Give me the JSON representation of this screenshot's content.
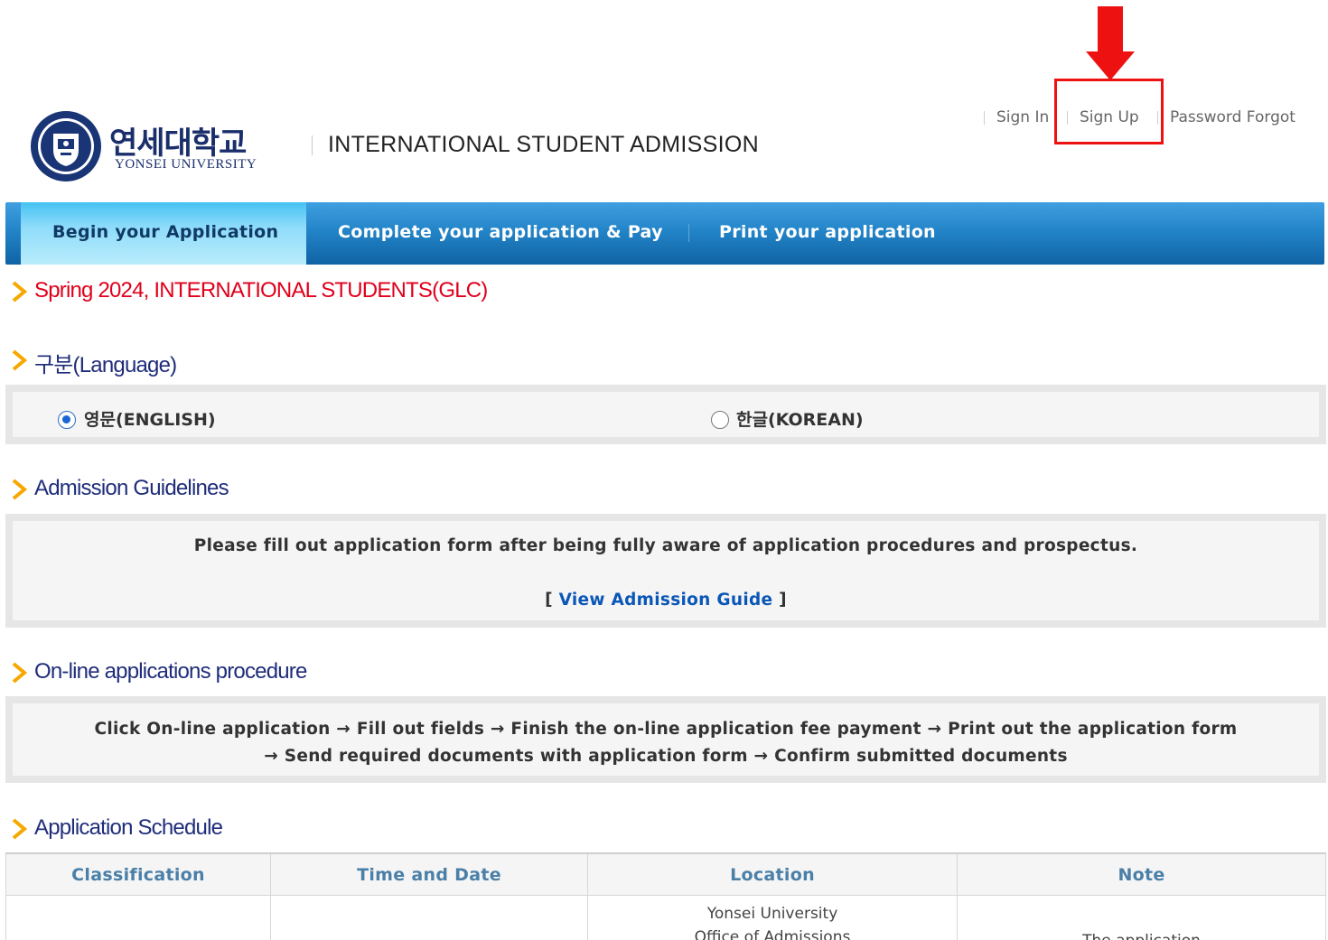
{
  "brand": {
    "name_ko": "연세대학교",
    "name_en": "YONSEI UNIVERSITY"
  },
  "site_title": "INTERNATIONAL STUDENT ADMISSION",
  "top_links": {
    "sign_in": "Sign In",
    "sign_up": "Sign Up",
    "password_forgot": "Password Forgot"
  },
  "nav": {
    "tabs": [
      {
        "label": "Begin your Application",
        "active": true
      },
      {
        "label": "Complete your application & Pay",
        "active": false
      },
      {
        "label": "Print your application",
        "active": false
      }
    ]
  },
  "term_heading": "Spring 2024, INTERNATIONAL STUDENTS(GLC)",
  "language": {
    "heading": "구분(Language)",
    "options": [
      {
        "label": "영문(ENGLISH)",
        "selected": true
      },
      {
        "label": "한글(KOREAN)",
        "selected": false
      }
    ]
  },
  "guidelines": {
    "heading": "Admission Guidelines",
    "text": "Please fill out application form after being fully aware of application procedures and prospectus.",
    "link_open": "[ ",
    "link_label": "View Admission Guide",
    "link_close": " ]"
  },
  "procedure": {
    "heading": "On-line applications procedure",
    "line1": "Click On-line application → Fill out fields → Finish the on-line application fee payment → Print out the application form",
    "line2": "→ Send required documents with application form → Confirm submitted documents"
  },
  "schedule": {
    "heading": "Application Schedule",
    "columns": [
      "Classification",
      "Time and Date",
      "Location",
      "Note"
    ],
    "first_row": {
      "classification": "",
      "time_and_date": "",
      "location_line1": "Yonsei University",
      "location_line2": "Office of Admissions",
      "note": "The application"
    }
  },
  "colors": {
    "accent_red": "#ee1111",
    "nav_blue": "#2384c8",
    "heading_navy": "#1f2d7a",
    "link_blue": "#0b57b8",
    "chevron_orange": "#f6a800"
  }
}
